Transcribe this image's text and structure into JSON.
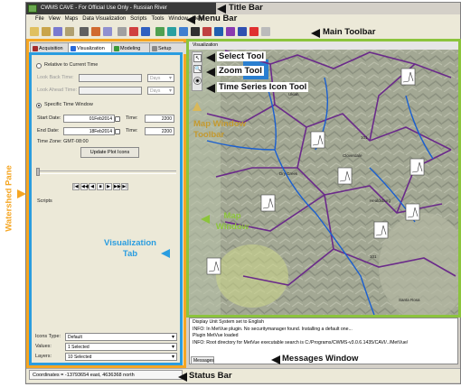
{
  "app": {
    "title": "CWMS CAVE - For Official Use Only  -  Russian River",
    "menu": [
      "File",
      "View",
      "Maps",
      "Data Visualization",
      "Scripts",
      "Tools",
      "Window",
      "Help"
    ]
  },
  "tabs": [
    {
      "label": "Acquisition",
      "color": "#a52a2a"
    },
    {
      "label": "Visualization",
      "color": "#2a6ad9"
    },
    {
      "label": "Modeling",
      "color": "#3a9a3a"
    },
    {
      "label": "Setup",
      "color": "#8a8a8a"
    }
  ],
  "visualization": {
    "relative_label": "Relative to Current Time",
    "look_back_label": "Look Back Time:",
    "look_ahead_label": "Look Ahead Time:",
    "days_unit": "Days",
    "specific_label": "Specific Time Window",
    "start_label": "Start Date:",
    "start_date": "01Feb2014",
    "start_time_label": "Time:",
    "start_time": "2200",
    "end_label": "End Date:",
    "end_date": "18Feb2014",
    "end_time_label": "Time:",
    "end_time": "2200",
    "timezone": "Time Zone:  GMT-08:00",
    "update_button": "Update Plot Icons",
    "media_buttons": [
      "|◀",
      "◀◀",
      "◀",
      "■",
      "▶",
      "▶▶",
      "▶|"
    ],
    "scripts_label": "Scripts",
    "icons_type_label": "Icons Type:",
    "icons_type_value": "Default",
    "values_label": "Values:",
    "values_value": "1 Selected",
    "layers_label": "Layers:",
    "layers_value": "10 Selected"
  },
  "map": {
    "window_title": "Visualization",
    "labels": [
      "101",
      "101",
      "Cloverdale",
      "Healdsburg",
      "Santa Rosa",
      "Ukiah",
      "Lake",
      "Dry Creek"
    ]
  },
  "messages": {
    "lines": [
      "Display Unit System set to English",
      "INFO: In MetVue plugin. No securitymanager found. Installing a default one...",
      "Plugin MetVue loaded",
      "INFO: Root directory for MetVue executable search is C:/Programs/CWMS-v3.0.6.1435/CAVI/../MetVue/"
    ],
    "tab_label": "Messages"
  },
  "status": {
    "coordinates": "Coordinates = -13793654 east, 4636368 north"
  },
  "callouts": {
    "title_bar": "Title Bar",
    "menu_bar": "Menu Bar",
    "main_toolbar": "Main Toolbar",
    "select_tool": "Select Tool",
    "zoom_tool": "Zoom Tool",
    "ts_icon_tool": "Time Series Icon Tool",
    "map_window_toolbar": "Map Window Toolbar",
    "map_window": "Map Window",
    "visualization_tab": "Visualization Tab",
    "watershed_pane": "Watershed Pane",
    "messages_window": "Messages Window",
    "status_bar": "Status Bar"
  },
  "colors": {
    "watershed_pane": "#f5a623",
    "visualization_tab": "#2a9de0",
    "map_window": "#8cc43c",
    "map_window_toolbar": "#d9b85a"
  }
}
